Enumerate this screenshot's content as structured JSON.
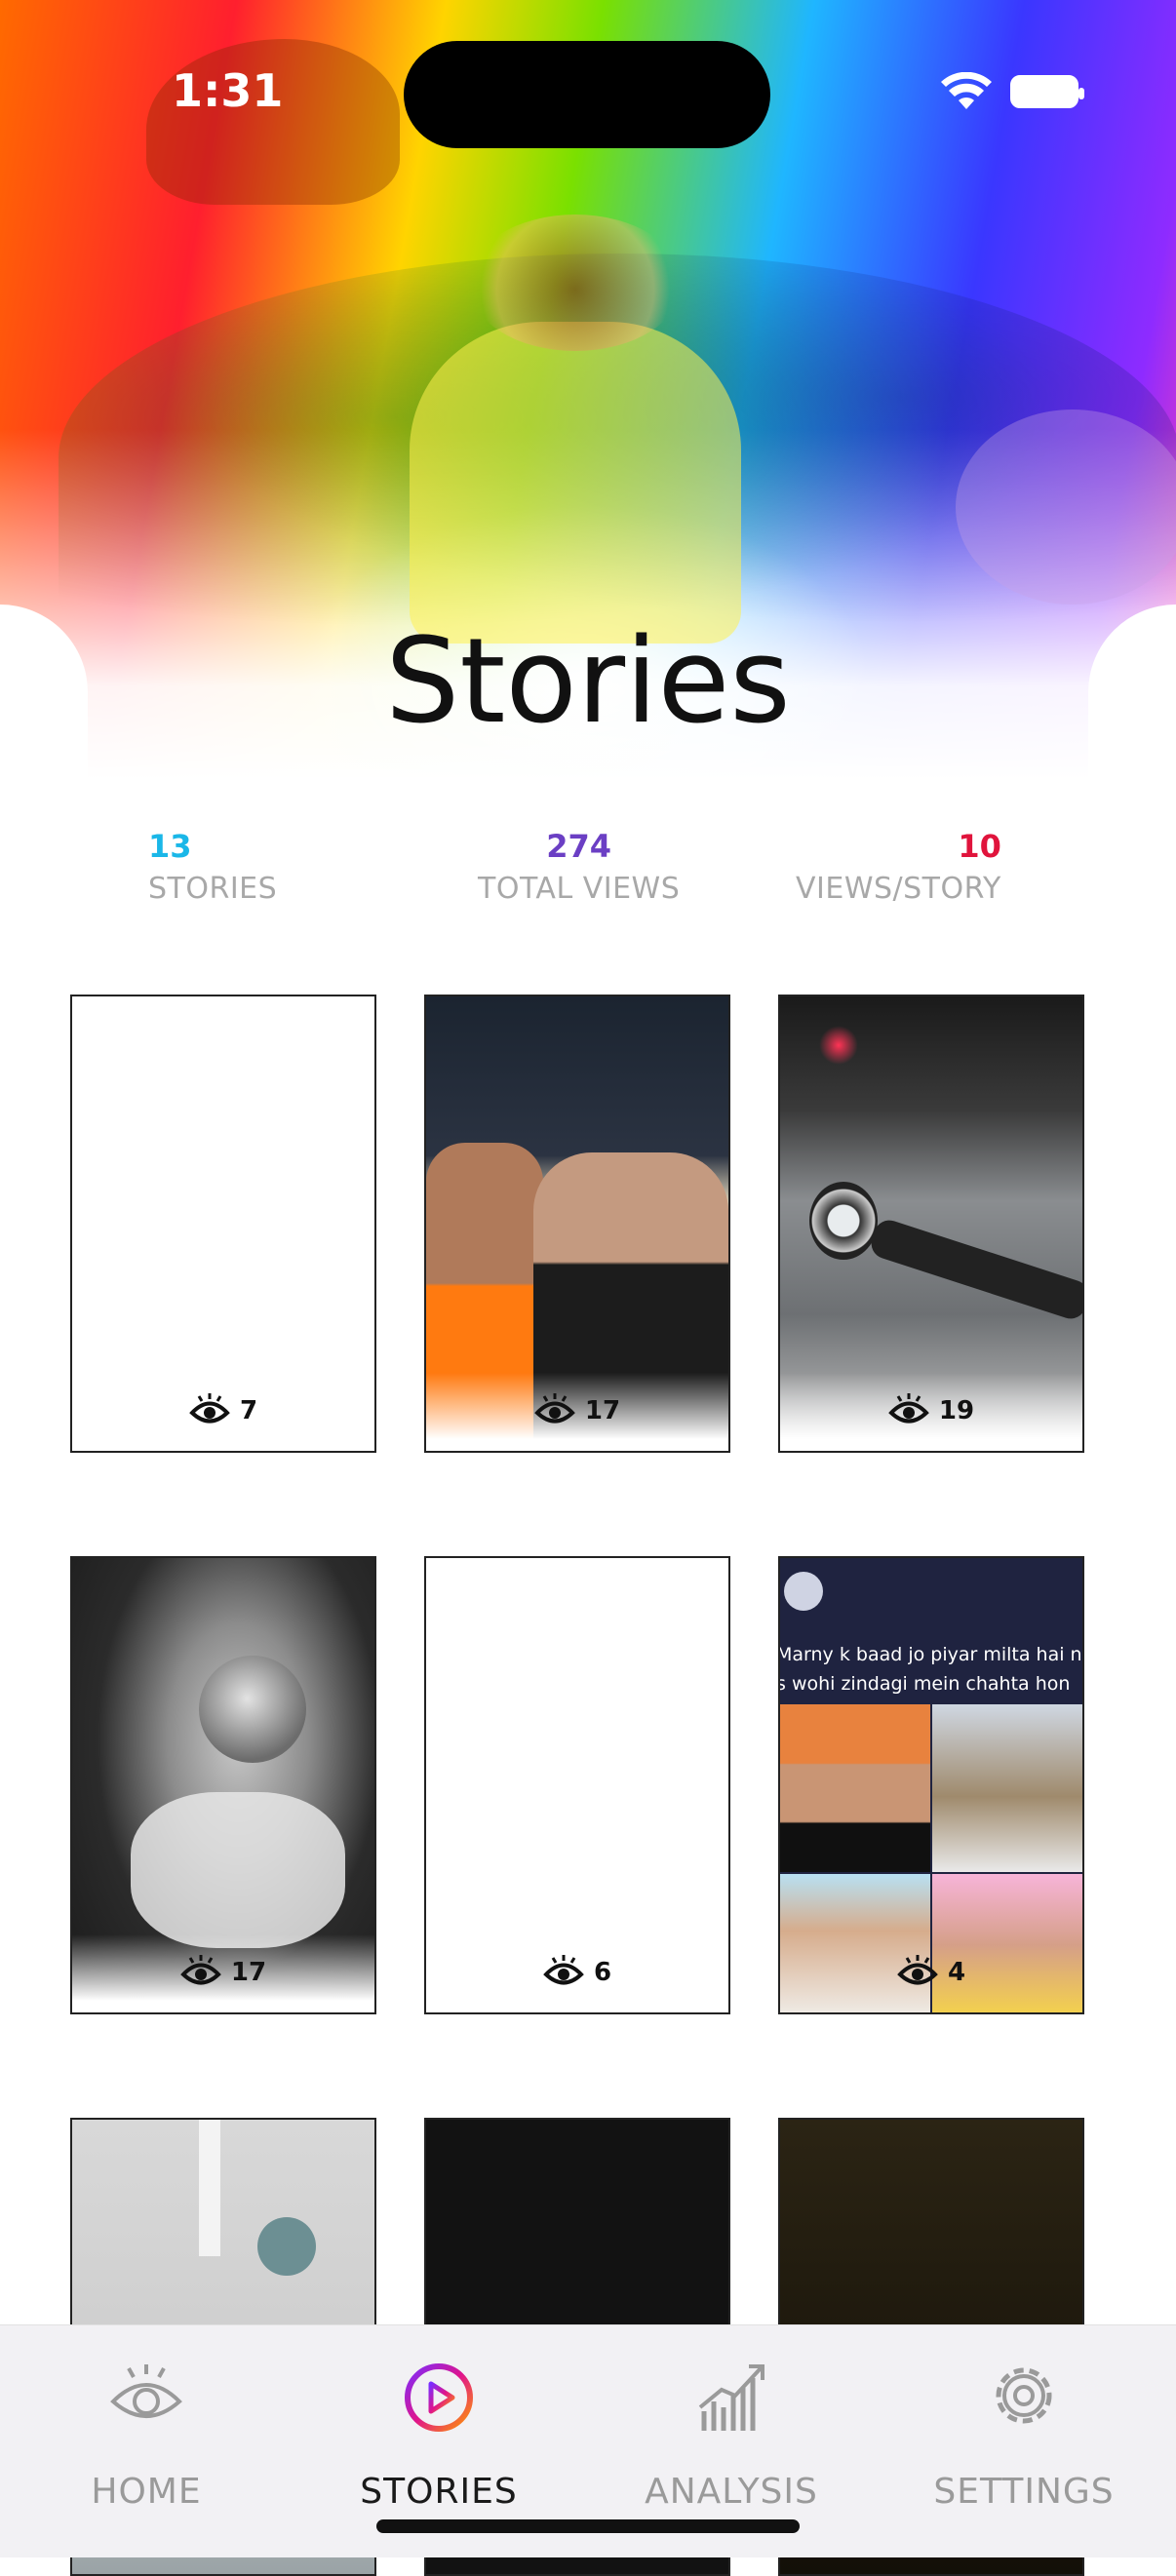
{
  "status_bar": {
    "time": "1:31"
  },
  "page": {
    "title": "Stories"
  },
  "stats": [
    {
      "value": "13",
      "label": "STORIES",
      "color": "#1ab7e8"
    },
    {
      "value": "274",
      "label": "TOTAL VIEWS",
      "color": "#6b3fc4"
    },
    {
      "value": "10",
      "label": "VIEWS/STORY",
      "color": "#e0143c"
    }
  ],
  "stories": [
    {
      "views": "7",
      "thumb": "blank"
    },
    {
      "views": "17",
      "thumb": "two-men-mosque-night"
    },
    {
      "views": "19",
      "thumb": "motorbike-road-night"
    },
    {
      "views": "17",
      "thumb": "blurred-helmet-rider"
    },
    {
      "views": "6",
      "thumb": "blank"
    },
    {
      "views": "4",
      "thumb": "text-collage",
      "caption_lines": [
        "Marny k baad jo piyar milta hai n",
        "s wohi zindagi mein chahta hon"
      ]
    },
    {
      "thumb": "motorbike-gauges"
    },
    {
      "thumb": "dark"
    },
    {
      "thumb": "night-people"
    }
  ],
  "tabs": [
    {
      "label": "HOME",
      "icon": "eye-icon",
      "active": false
    },
    {
      "label": "STORIES",
      "icon": "stories-play-icon",
      "active": true,
      "accent": "#e0148c"
    },
    {
      "label": "ANALYSIS",
      "icon": "bar-chart-icon",
      "active": false
    },
    {
      "label": "SETTINGS",
      "icon": "gear-icon",
      "active": false
    }
  ]
}
